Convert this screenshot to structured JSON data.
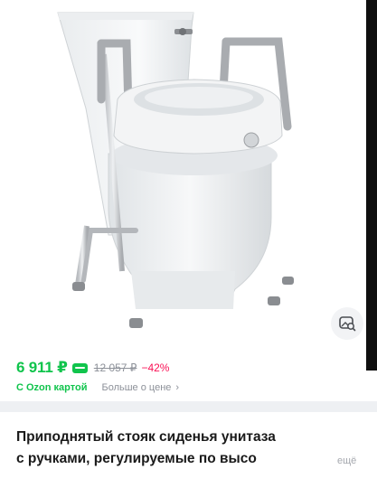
{
  "price": {
    "current": "6 911 ₽",
    "old": "12 057 ₽",
    "discount": "−42%",
    "ozon_card_label": "С Ozon картой",
    "more_about_price": "Больше о цене",
    "chevron": "›"
  },
  "product": {
    "image_icon": "toilet-seat-riser-with-handles-photo",
    "title_line1": "Приподнятый стояк сиденья унитаза",
    "title_line2": "с ручками, регулируемые по высо",
    "more_link": "ещё"
  },
  "icons": {
    "similar": "image-search-icon",
    "wallet": "ozon-card-icon"
  },
  "colors": {
    "accent_green": "#10c44c",
    "discount_red": "#f91155",
    "muted_gray": "#8d9199"
  }
}
